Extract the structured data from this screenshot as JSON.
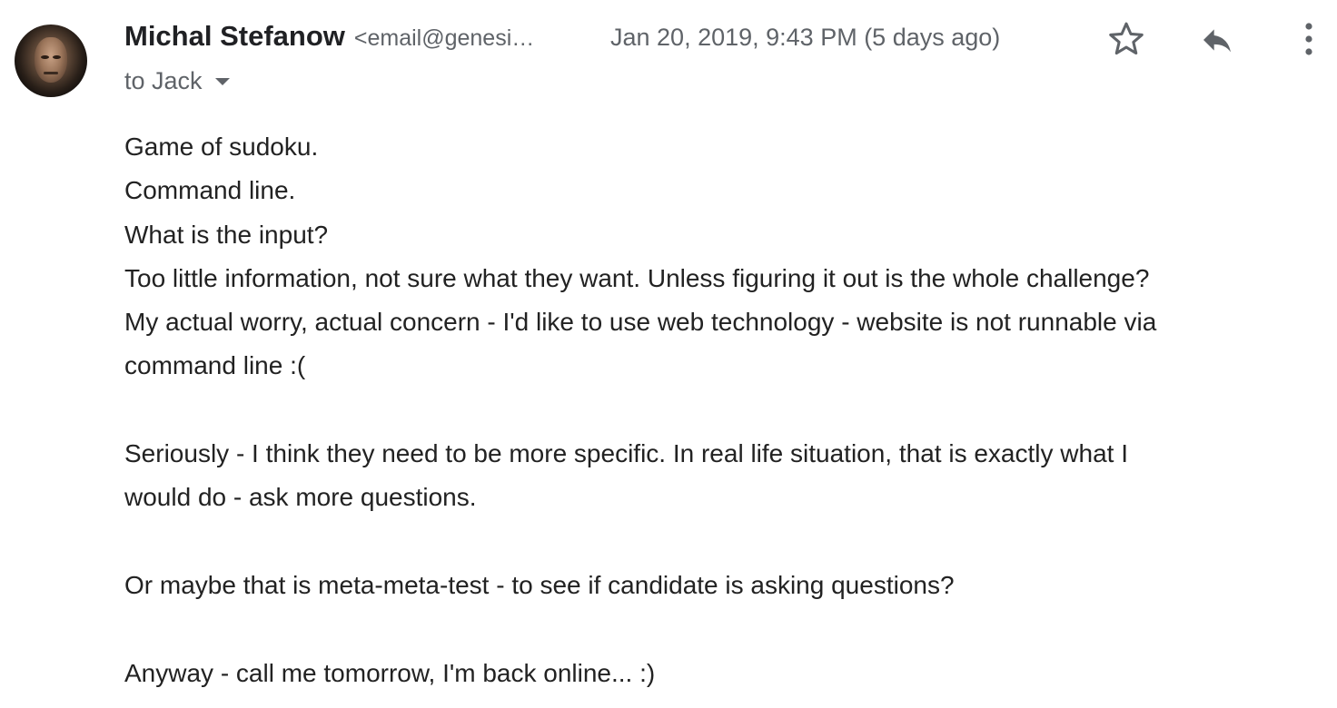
{
  "message": {
    "sender_name": "Michal Stefanow",
    "sender_email": "<email@genesi…",
    "date": "Jan 20, 2019, 9:43 PM (5 days ago)",
    "to": "to Jack",
    "body_lines": [
      "Game of sudoku.",
      "Command line.",
      "What is the input?",
      "Too little information, not sure what they want. Unless figuring it out is the whole challenge?",
      "My actual worry, actual concern - I'd like to use web technology - website is not runnable via",
      "command line :(",
      "",
      "Seriously - I think they need to be more specific. In real life situation, that is exactly what I",
      "would do - ask more questions.",
      "",
      "Or maybe that is meta-meta-test - to see if candidate is asking questions?",
      "",
      "Anyway - call me tomorrow, I'm back online... :)"
    ]
  },
  "icons": {
    "avatar": "avatar-photo",
    "star": "star-icon",
    "reply": "reply-icon",
    "more": "more-vert-icon",
    "recipients": "chevron-down-icon"
  },
  "colors": {
    "text_primary": "#202124",
    "text_secondary": "#5f6368",
    "icon": "#5f6368"
  }
}
